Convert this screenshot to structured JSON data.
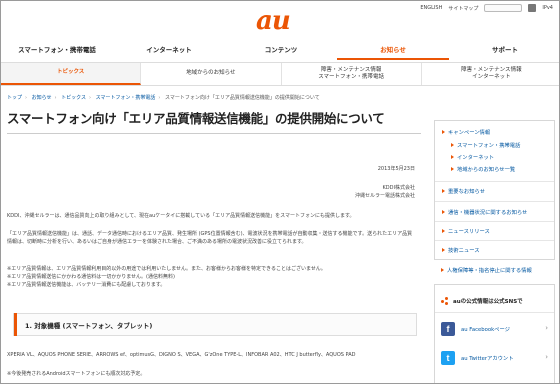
{
  "util": {
    "english": "ENGLISH",
    "sitemap": "サイトマップ",
    "ipv4": "IPv4"
  },
  "logo": "au",
  "global_nav": [
    {
      "label": "スマートフォン・携帯電話",
      "active": false
    },
    {
      "label": "インターネット",
      "active": false
    },
    {
      "label": "コンテンツ",
      "active": false
    },
    {
      "label": "お知らせ",
      "active": true
    },
    {
      "label": "サポート",
      "active": false
    }
  ],
  "sub_nav": [
    {
      "label": "トピックス",
      "active": true
    },
    {
      "label": "地域からのお知らせ",
      "active": false
    },
    {
      "label": "障害・メンテナンス情報\nスマートフォン・携帯電話",
      "active": false
    },
    {
      "label": "障害・メンテナンス情報\nインターネット",
      "active": false
    }
  ],
  "breadcrumb": [
    "トップ",
    "お知らせ",
    "トピックス",
    "スマートフォン・携帯電話",
    "スマートフォン向け「エリア品質情報送信機能」の提供開始について"
  ],
  "article": {
    "title": "スマートフォン向け「エリア品質情報送信機能」の提供開始について",
    "date": "2013年5月23日",
    "company1": "KDDI株式会社",
    "company2": "沖縄セルラー電話株式会社",
    "para1": "KDDI、沖縄セルラーは、通信品質向上の取り組みとして、現在auケータイに搭載している「エリア品質情報送信機能」をスマートフォンにも提供します。",
    "para2": "「エリア品質情報送信機能」は、通話、データ通信時におけるエリア品質、発生場所 (GPS位置情報含む)、電波状況を携帯電話が自動収集・送信する機能です。送られたエリア品質情報は、切断時に分析を行い、あるいはご自身が通信エラーを体験された場合、ご不満のある場所の電波状況改善に役立てられます。",
    "para3": "※エリア品質情報は、エリア品質情報利用目的以外の用途では利用いたしません。また、お客様からお客様を特定できることはございません。\n※エリア品質情報送信にかかわる通信料は一切かかりません。(通信料無料)\n※エリア品質情報送信機能は、バッテリー消費にも配慮しております。",
    "section1": "1. 対象機種 (スマートフォン、タブレット)",
    "models": "XPERIA VL、AQUOS PHONE SERIE、ARROWS ef、optimusG、DIGNO S、VEGA、G'zOne TYPE-L、INFOBAR A02、HTC J butterfly、AQUOS PAD",
    "note": "※今後発売されるAndroidスマートフォンにも順次対応予定。"
  },
  "side": {
    "category": "キャンペーン情報",
    "items": [
      "スマートフォン・携帯電話",
      "インターネット",
      "地域からのお知らせ一覧"
    ],
    "links": [
      "重要なお知らせ",
      "通信・機器状況に関するお知らせ",
      "ニュースリリース",
      "技術ニュース",
      "人権保障等・指名停止に関する情報"
    ]
  },
  "sns": {
    "heading": "auの公式情報は公式SNSで",
    "facebook": "au Facebookページ",
    "twitter": "au Twitterアカウント"
  },
  "colors": {
    "accent": "#eb5505",
    "link": "#0056a0",
    "facebook": "#3b5998",
    "twitter": "#1da1f2"
  }
}
